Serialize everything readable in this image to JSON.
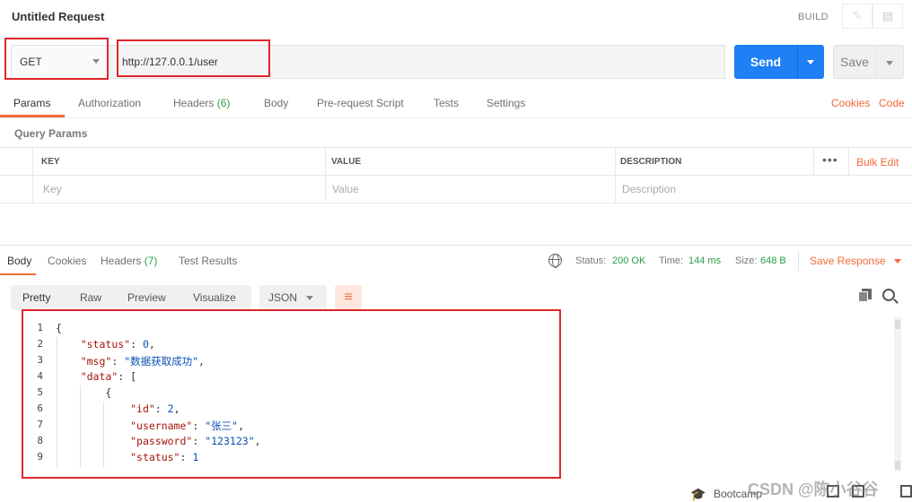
{
  "header": {
    "title": "Untitled Request",
    "build_label": "BUILD",
    "pencil_icon": "pencil-icon",
    "doc_icon": "document-icon"
  },
  "request": {
    "method": "GET",
    "url": "http://127.0.0.1/user",
    "send_label": "Send",
    "save_label": "Save"
  },
  "request_tabs": {
    "params": "Params",
    "authorization": "Authorization",
    "headers": "Headers",
    "headers_count": "(6)",
    "body": "Body",
    "prerequest": "Pre-request Script",
    "tests": "Tests",
    "settings": "Settings",
    "cookies": "Cookies",
    "code": "Code"
  },
  "params": {
    "section_title": "Query Params",
    "col_key": "KEY",
    "col_value": "VALUE",
    "col_description": "DESCRIPTION",
    "more_icon": "•••",
    "bulk_edit": "Bulk Edit",
    "key_placeholder": "Key",
    "value_placeholder": "Value",
    "description_placeholder": "Description"
  },
  "response_tabs": {
    "body": "Body",
    "cookies": "Cookies",
    "headers": "Headers",
    "headers_count": "(7)",
    "test_results": "Test Results"
  },
  "response_meta": {
    "status_label": "Status:",
    "status_value": "200 OK",
    "time_label": "Time:",
    "time_value": "144 ms",
    "size_label": "Size:",
    "size_value": "648 B",
    "save_response": "Save Response"
  },
  "response_toolbar": {
    "pretty": "Pretty",
    "raw": "Raw",
    "preview": "Preview",
    "visualize": "Visualize",
    "format": "JSON",
    "wrap_icon": "wrap-lines-icon"
  },
  "code_lines": [
    {
      "num": "1",
      "text": "{"
    },
    {
      "num": "2",
      "text": "    \"status\": 0,"
    },
    {
      "num": "3",
      "text": "    \"msg\": \"数据获取成功\","
    },
    {
      "num": "4",
      "text": "    \"data\": ["
    },
    {
      "num": "5",
      "text": "        {"
    },
    {
      "num": "6",
      "text": "            \"id\": 2,"
    },
    {
      "num": "7",
      "text": "            \"username\": \"张三\","
    },
    {
      "num": "8",
      "text": "            \"password\": \"123123\","
    },
    {
      "num": "9",
      "text": "            \"status\": 1"
    }
  ],
  "footer": {
    "bootcamp": "Bootcamp",
    "watermark": "CSDN @陈小谷谷"
  },
  "colors": {
    "accent": "#f26b3a",
    "send_blue": "#1f7ff5",
    "success_green": "#2a9d48",
    "highlight_red": "#e0262b"
  }
}
